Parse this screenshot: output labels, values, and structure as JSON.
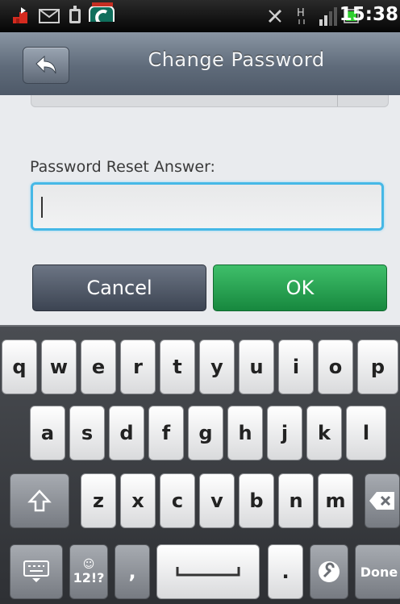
{
  "status_bar": {
    "time": "15:38",
    "icons": [
      "alert-icon",
      "mail-icon",
      "usb-icon",
      "comodo-app-icon",
      "sync-icon",
      "signal-h-icon",
      "signal-bars-icon",
      "battery-icon"
    ]
  },
  "header": {
    "title": "Change Password",
    "back_icon": "back-arrow-icon"
  },
  "form": {
    "answer_label": "Password Reset Answer:",
    "answer_value": ""
  },
  "buttons": {
    "cancel": "Cancel",
    "ok": "OK"
  },
  "keyboard": {
    "row1": [
      "q",
      "w",
      "e",
      "r",
      "t",
      "y",
      "u",
      "i",
      "o",
      "p"
    ],
    "row2": [
      "a",
      "s",
      "d",
      "f",
      "g",
      "h",
      "j",
      "k",
      "l"
    ],
    "row3": [
      "z",
      "x",
      "c",
      "v",
      "b",
      "n",
      "m"
    ],
    "symbols": "12!?",
    "comma": ",",
    "period": ".",
    "done": "Done"
  },
  "colors": {
    "ok_green": "#17883e",
    "focus_blue": "#46b8e6"
  }
}
